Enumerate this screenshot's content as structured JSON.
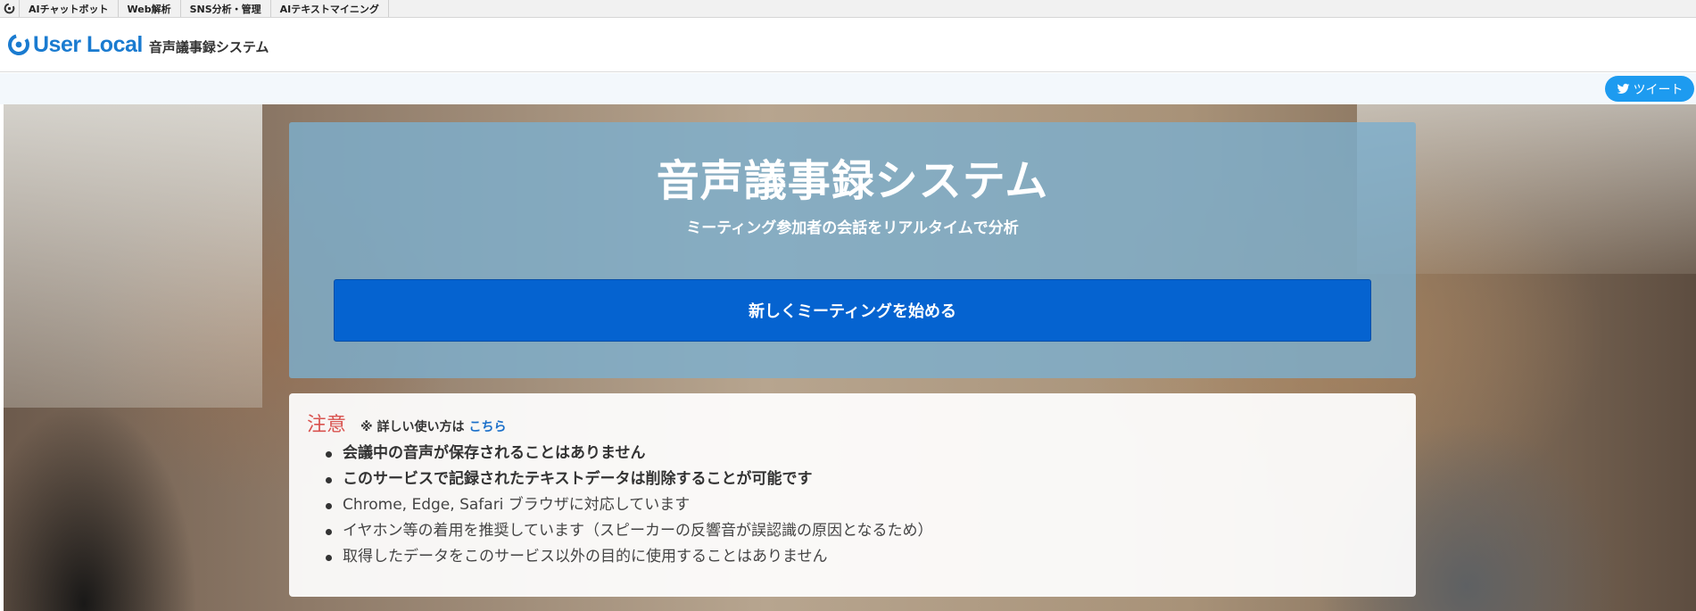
{
  "topbar": {
    "logo_icon": "userlocal-mark-icon",
    "links": [
      "AIチャットボット",
      "Web解析",
      "SNS分析・管理",
      "AIテキストマイニング"
    ]
  },
  "header": {
    "brand_name": "User Local",
    "product_name": "音声議事録システム",
    "brand_color": "#1a7bd0"
  },
  "share": {
    "tweet_label": "ツイート",
    "tweet_icon": "twitter-bird-icon",
    "tweet_color": "#1d9bf0"
  },
  "intro": {
    "title": "音声議事録システム",
    "subtitle": "ミーティング参加者の会話をリアルタイムで分析",
    "start_button": "新しくミーティングを始める",
    "button_color": "#0563d0"
  },
  "notice": {
    "title": "注意",
    "note": "※ 詳しい使い方は",
    "link": "こちら",
    "items": [
      "会議中の音声が保存されることはありません",
      "このサービスで記録されたテキストデータは削除することが可能です",
      "Chrome, Edge, Safari ブラウザに対応しています",
      "イヤホン等の着用を推奨しています（スピーカーの反響音が誤認識の原因となるため）",
      "取得したデータをこのサービス以外の目的に使用することはありません"
    ],
    "title_color": "#d9534f",
    "link_color": "#1a6fc9"
  }
}
